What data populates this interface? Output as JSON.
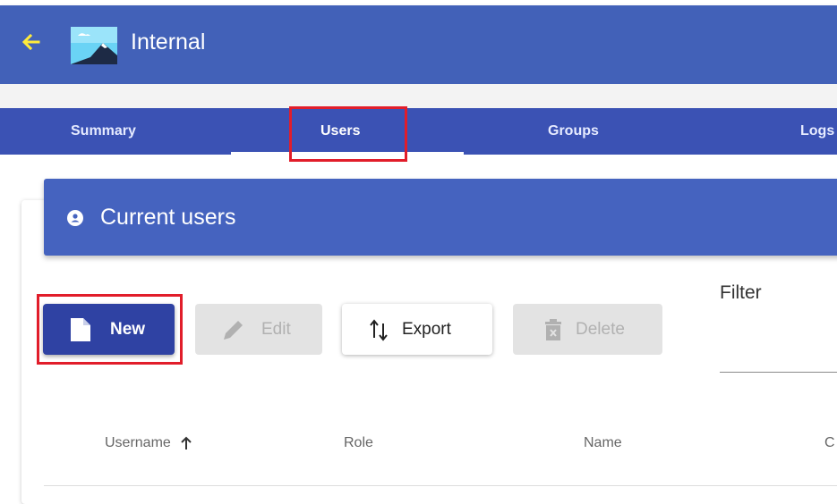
{
  "app": {
    "title": "Internal",
    "back_icon": "arrow-left-icon",
    "image_icon": "landscape-image-icon",
    "back_color": "#ffeb3b"
  },
  "tabs": [
    {
      "label": "Summary",
      "active": false
    },
    {
      "label": "Users",
      "active": true
    },
    {
      "label": "Groups",
      "active": false
    },
    {
      "label": "Logs",
      "active": false
    }
  ],
  "card": {
    "title": "Current users",
    "icon": "account-circle-icon"
  },
  "toolbar": {
    "new_label": "New",
    "edit_label": "Edit",
    "export_label": "Export",
    "delete_label": "Delete",
    "new_icon": "file-icon",
    "edit_icon": "pencil-icon",
    "export_icon": "sort-arrows-icon",
    "delete_icon": "trash-icon"
  },
  "filter": {
    "label": "Filter",
    "value": ""
  },
  "table": {
    "columns": [
      "Username",
      "Role",
      "Name",
      "C"
    ],
    "sort_column": "Username",
    "sort_direction": "ascending"
  },
  "colors": {
    "header": "#4261b8",
    "tabs": "#3b52b4",
    "primary_button": "#2f42a3",
    "highlight": "#e11d2a"
  }
}
